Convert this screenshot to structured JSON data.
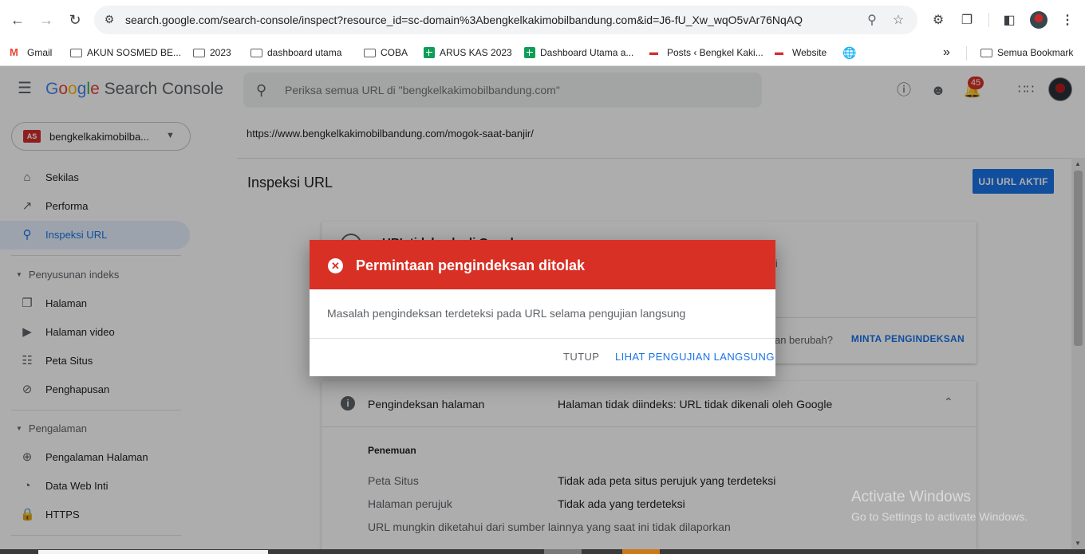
{
  "browser": {
    "url": "search.google.com/search-console/inspect?resource_id=sc-domain%3Abengkelkakimobilbandung.com&id=J6-fU_Xw_wqO5vAr76NqAQ",
    "bookmarks": [
      "Gmail",
      "AKUN SOSMED BE...",
      "2023",
      "dashboard utama",
      "COBA",
      "ARUS KAS 2023",
      "Dashboard Utama a...",
      "Posts ‹ Bengkel Kaki...",
      "Website"
    ],
    "all_bookmarks": "Semua Bookmark"
  },
  "app": {
    "logo_google": "Google",
    "logo_product": "Search Console",
    "search_placeholder": "Periksa semua URL di \"bengkelkakimobilbandung.com\"",
    "notification_count": "45",
    "property_icon_text": "AS",
    "property_name": "bengkelkakimobilba..."
  },
  "sidebar": {
    "items_top": [
      {
        "label": "Sekilas",
        "icon": "home-icon"
      },
      {
        "label": "Performa",
        "icon": "trending-up-icon"
      },
      {
        "label": "Inspeksi URL",
        "icon": "search-icon",
        "active": true
      }
    ],
    "section_index": "Penyusunan indeks",
    "items_index": [
      {
        "label": "Halaman",
        "icon": "pages-icon"
      },
      {
        "label": "Halaman video",
        "icon": "video-page-icon"
      },
      {
        "label": "Peta Situs",
        "icon": "sitemap-icon"
      },
      {
        "label": "Penghapusan",
        "icon": "removal-icon"
      }
    ],
    "section_experience": "Pengalaman",
    "items_experience": [
      {
        "label": "Pengalaman Halaman",
        "icon": "plus-circle-icon"
      },
      {
        "label": "Data Web Inti",
        "icon": "gauge-icon"
      },
      {
        "label": "HTTPS",
        "icon": "lock-icon"
      }
    ]
  },
  "main": {
    "inspected_url": "https://www.bengkelkakimobilbandung.com/mogok-saat-banjir/",
    "page_title": "Inspeksi URL",
    "live_test_button": "UJI URL AKTIF",
    "card1": {
      "title_partial": "URL tidak ada di Google",
      "cut_text": "li",
      "hint_partial": "an berubah?",
      "request_index": "MINTA PENGINDEKSAN"
    },
    "card2": {
      "heading": "Pengindeksan halaman",
      "status": "Halaman tidak diindeks: URL tidak dikenali oleh Google",
      "subheading": "Penemuan",
      "rows": [
        {
          "key": "Peta Situs",
          "value": "Tidak ada peta situs perujuk yang terdeteksi"
        },
        {
          "key": "Halaman perujuk",
          "value": "Tidak ada yang terdeteksi"
        }
      ],
      "footnote": "URL mungkin diketahui dari sumber lainnya yang saat ini tidak dilaporkan"
    }
  },
  "dialog": {
    "title": "Permintaan pengindeksan ditolak",
    "body": "Masalah pengindeksan terdeteksi pada URL selama pengujian langsung",
    "close_label": "TUTUP",
    "live_label": "LIHAT PENGUJIAN LANGSUNG"
  },
  "watermark": {
    "line1": "Activate Windows",
    "line2": "Go to Settings to activate Windows."
  },
  "colors": {
    "dialog_header": "#d93025",
    "accent": "#1a73e8"
  }
}
